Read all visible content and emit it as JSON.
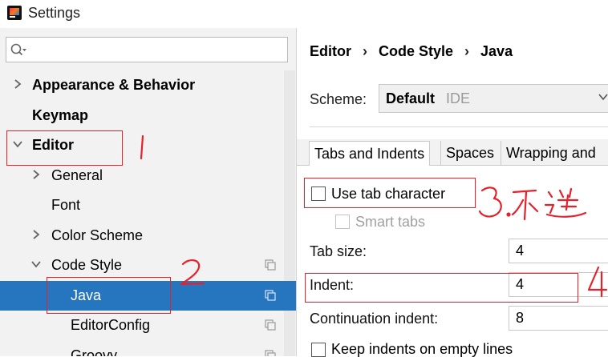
{
  "window": {
    "title": "Settings"
  },
  "sidebar": {
    "search": {
      "placeholder": "",
      "value": ""
    },
    "items": [
      {
        "label": "Appearance & Behavior",
        "bold": true,
        "expanded": false
      },
      {
        "label": "Keymap",
        "bold": true
      },
      {
        "label": "Editor",
        "bold": true,
        "expanded": true
      },
      {
        "label": "General",
        "expanded": false
      },
      {
        "label": "Font"
      },
      {
        "label": "Color Scheme",
        "expanded": false
      },
      {
        "label": "Code Style",
        "expanded": true
      },
      {
        "label": "Java",
        "selected": true
      },
      {
        "label": "EditorConfig"
      },
      {
        "label": "Groovy"
      }
    ]
  },
  "breadcrumb": {
    "items": [
      "Editor",
      "Code Style",
      "Java"
    ]
  },
  "scheme": {
    "label": "Scheme:",
    "value": "Default",
    "tag": "IDE"
  },
  "tabs": [
    "Tabs and Indents",
    "Spaces",
    "Wrapping and"
  ],
  "settings": {
    "use_tab_character": {
      "label": "Use tab character",
      "checked": false
    },
    "smart_tabs": {
      "label": "Smart tabs",
      "checked": false,
      "disabled": true
    },
    "tab_size": {
      "label": "Tab size:",
      "value": "4"
    },
    "indent": {
      "label": "Indent:",
      "value": "4"
    },
    "continuation_indent": {
      "label": "Continuation indent:",
      "value": "8"
    },
    "keep_indents": {
      "label": "Keep indents on empty lines",
      "checked": false
    }
  },
  "annotations": {
    "color": "#e8202a",
    "notes": [
      "1",
      "2",
      "3.不选",
      "4"
    ]
  },
  "colors": {
    "selection": "#2675bf",
    "sidebar_bg": "#f2f2f2"
  }
}
